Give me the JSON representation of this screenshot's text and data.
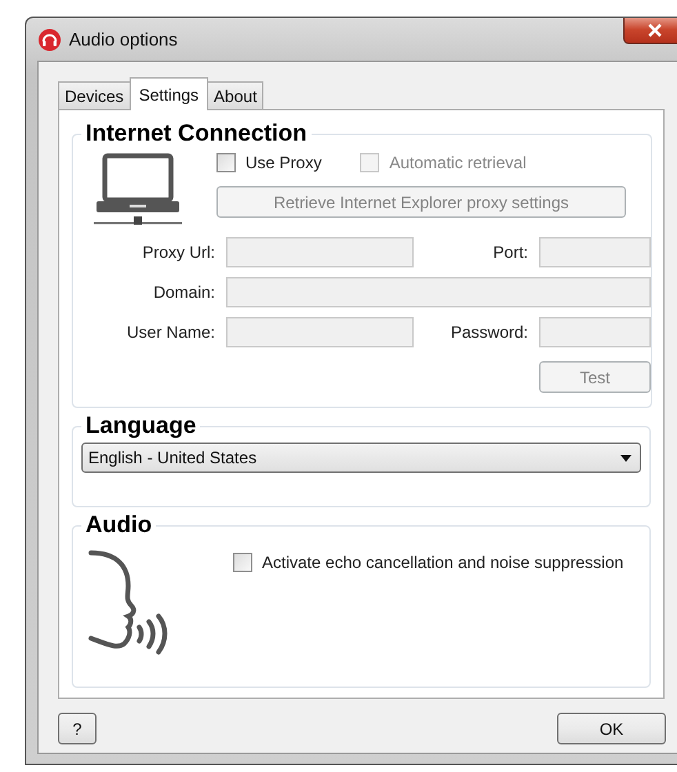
{
  "window": {
    "title": "Audio options"
  },
  "tabs": [
    {
      "label": "Devices",
      "selected": false
    },
    {
      "label": "Settings",
      "selected": true
    },
    {
      "label": "About",
      "selected": false
    }
  ],
  "internet_connection": {
    "title": "Internet Connection",
    "use_proxy": {
      "label": "Use Proxy",
      "checked": false,
      "disabled": false
    },
    "automatic_retrieval": {
      "label": "Automatic retrieval",
      "checked": false,
      "disabled": true
    },
    "retrieve_button": {
      "label": "Retrieve Internet Explorer proxy settings",
      "disabled": true
    },
    "proxy_url": {
      "label": "Proxy Url:",
      "disabled": true
    },
    "port": {
      "label": "Port:",
      "disabled": true
    },
    "domain": {
      "label": "Domain:",
      "disabled": true
    },
    "user_name": {
      "label": "User Name:",
      "disabled": true
    },
    "password": {
      "label": "Password:",
      "disabled": true
    },
    "test_button": {
      "label": "Test",
      "disabled": true
    }
  },
  "language": {
    "title": "Language",
    "value": "English - United States"
  },
  "audio": {
    "title": "Audio",
    "echo_cancellation": {
      "label": "Activate echo cancellation and noise suppression",
      "checked": false,
      "disabled": false
    }
  },
  "buttons": {
    "help": "?",
    "ok": "OK"
  }
}
